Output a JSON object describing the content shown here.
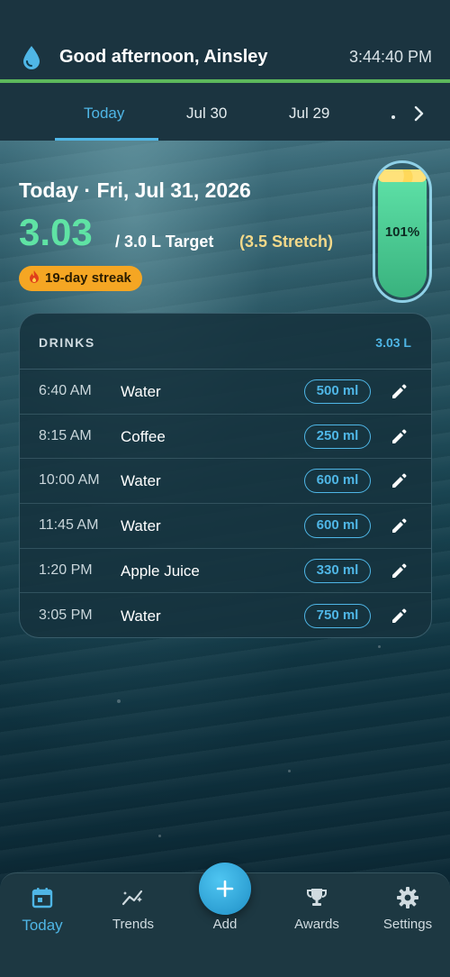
{
  "header": {
    "greeting": "Good afternoon, Ainsley",
    "time": "3:44:40 PM",
    "accent_color": "#5cb85c",
    "icon": "water-drop-icon"
  },
  "tabs": {
    "items": [
      {
        "label": "Today",
        "active": true
      },
      {
        "label": "Jul 30",
        "active": false
      },
      {
        "label": "Jul 29",
        "active": false
      }
    ],
    "next_icon": "chevron-right-icon"
  },
  "summary": {
    "date_title": "Today · Fri, Jul 31, 2026",
    "amount": "3.03",
    "target": "/ 3.0 L Target",
    "stretch": "(3.5 Stretch)",
    "streak": "19-day streak",
    "progress_percent": 101,
    "progress_label": "101%"
  },
  "drinks": {
    "title": "DRINKS",
    "total": "3.03 L",
    "rows": [
      {
        "time": "6:40 AM",
        "name": "Water",
        "volume": "500 ml"
      },
      {
        "time": "8:15 AM",
        "name": "Coffee",
        "volume": "250 ml"
      },
      {
        "time": "10:00 AM",
        "name": "Water",
        "volume": "600 ml"
      },
      {
        "time": "11:45 AM",
        "name": "Water",
        "volume": "600 ml"
      },
      {
        "time": "1:20 PM",
        "name": "Apple Juice",
        "volume": "330 ml"
      },
      {
        "time": "3:05 PM",
        "name": "Water",
        "volume": "750 ml"
      }
    ]
  },
  "nav": {
    "today": "Today",
    "trends": "Trends",
    "add": "Add",
    "awards": "Awards",
    "settings": "Settings"
  },
  "colors": {
    "accent_blue": "#4fb6e6",
    "amount_green": "#5fe3a4",
    "streak_orange": "#f5a623",
    "stretch_yellow": "#f3d98a"
  }
}
